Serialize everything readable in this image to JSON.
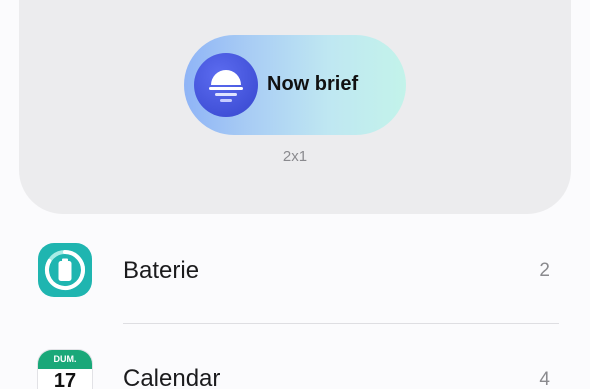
{
  "widget_preview": {
    "widget_name": "Now brief",
    "size": "2x1",
    "icon": "sunrise-icon"
  },
  "widget_list": [
    {
      "label": "Baterie",
      "count": "2",
      "icon": "battery-icon"
    },
    {
      "label": "Calendar",
      "count": "4",
      "icon": "calendar-icon",
      "icon_text": {
        "weekday": "DUM.",
        "day": "17"
      }
    }
  ],
  "colors": {
    "battery_icon": "#1fb5b0",
    "calendar_header": "#1aa879",
    "now_brief_icon": "#4151d8"
  }
}
